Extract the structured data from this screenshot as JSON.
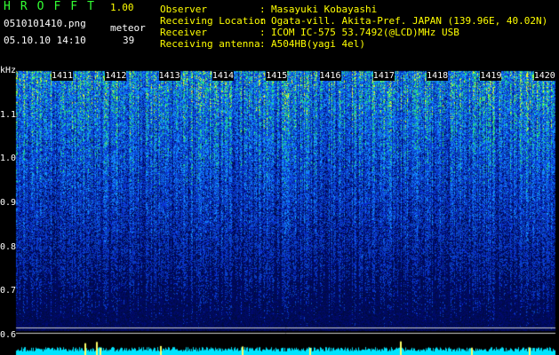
{
  "app": {
    "title": "HROFFT",
    "version": "1.00",
    "file_name": "0510101410.png",
    "date_time": "05.10.10 14:10",
    "mode_label": "meteor",
    "count_value": "39"
  },
  "info": [
    {
      "label": "Observer",
      "value": "Masayuki Kobayashi"
    },
    {
      "label": "Receiving Location",
      "value": "Ogata-vill. Akita-Pref. JAPAN (139.96E, 40.02N)"
    },
    {
      "label": "Receiver",
      "value": "ICOM IC-575 53.7492(@LCD)MHz USB"
    },
    {
      "label": "Receiving antenna",
      "value": "A504HB(yagi 4el)"
    }
  ],
  "spectrogram": {
    "y_unit": "kHz",
    "y_ticks": [
      "1.1",
      "1.0",
      "0.9",
      "0.8",
      "0.7",
      "0.6"
    ],
    "time_ticks": [
      "1411",
      "1412",
      "1413",
      "1414",
      "1415",
      "1416",
      "1417",
      "1418",
      "1419",
      "1420"
    ],
    "colors": {
      "background": "#000000",
      "signal_low": "#0a1f8a",
      "signal_mid": "#1e6bff",
      "signal_high": "#ffff00",
      "baseline": "#00e5ff",
      "axis_text": "#ffffff"
    }
  }
}
